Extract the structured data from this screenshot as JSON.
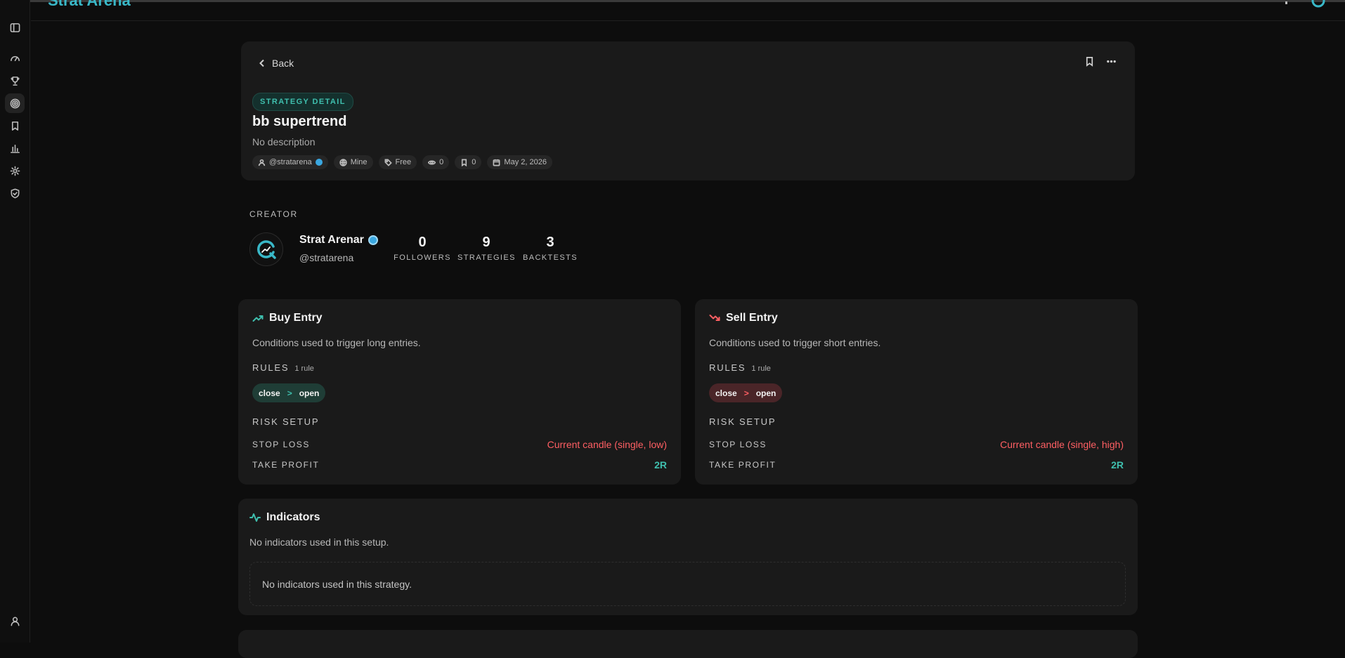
{
  "app": {
    "name": "Strat Arena"
  },
  "nav": {
    "items": [
      {
        "icon": "panel-left-icon"
      },
      {
        "icon": "gauge-icon"
      },
      {
        "icon": "trophy-icon"
      },
      {
        "icon": "target-icon",
        "active": true
      },
      {
        "icon": "bookmark-icon"
      },
      {
        "icon": "chart-icon"
      },
      {
        "icon": "gear-icon"
      },
      {
        "icon": "shield-icon"
      }
    ],
    "bottom": {
      "icon": "user-icon"
    }
  },
  "strategy": {
    "back_label": "Back",
    "badge": "STRATEGY DETAIL",
    "title": "bb supertrend",
    "description": "No description",
    "meta": {
      "author": "@stratarena",
      "visibility": "Mine",
      "pricing": "Free",
      "views": "0",
      "bookmarks": "0",
      "date": "May 2, 2026"
    }
  },
  "creator": {
    "section_label": "CREATOR",
    "name": "Strat Arenar",
    "handle": "@stratarena",
    "stats": [
      {
        "value": "0",
        "label": "FOLLOWERS"
      },
      {
        "value": "9",
        "label": "STRATEGIES"
      },
      {
        "value": "3",
        "label": "BACKTESTS"
      }
    ]
  },
  "buy": {
    "title": "Buy Entry",
    "description": "Conditions used to trigger long entries.",
    "rules_label": "RULES",
    "rules_count": "1 rule",
    "rule": {
      "left": "close",
      "op": ">",
      "right": "open"
    },
    "risk_label": "RISK SETUP",
    "stop_loss_label": "STOP LOSS",
    "stop_loss_value": "Current candle (single, low)",
    "take_profit_label": "TAKE PROFIT",
    "take_profit_value": "2R"
  },
  "sell": {
    "title": "Sell Entry",
    "description": "Conditions used to trigger short entries.",
    "rules_label": "RULES",
    "rules_count": "1 rule",
    "rule": {
      "left": "close",
      "op": ">",
      "right": "open"
    },
    "risk_label": "RISK SETUP",
    "stop_loss_label": "STOP LOSS",
    "stop_loss_value": "Current candle (single, high)",
    "take_profit_label": "TAKE PROFIT",
    "take_profit_value": "2R"
  },
  "indicators": {
    "title": "Indicators",
    "description": "No indicators used in this setup.",
    "empty_text": "No indicators used in this strategy."
  },
  "colors": {
    "accent": "#3fbfae",
    "danger": "#ff5f63",
    "verified": "#3aa7e0",
    "background": "#0d0d0d",
    "card": "#1a1a1a"
  }
}
